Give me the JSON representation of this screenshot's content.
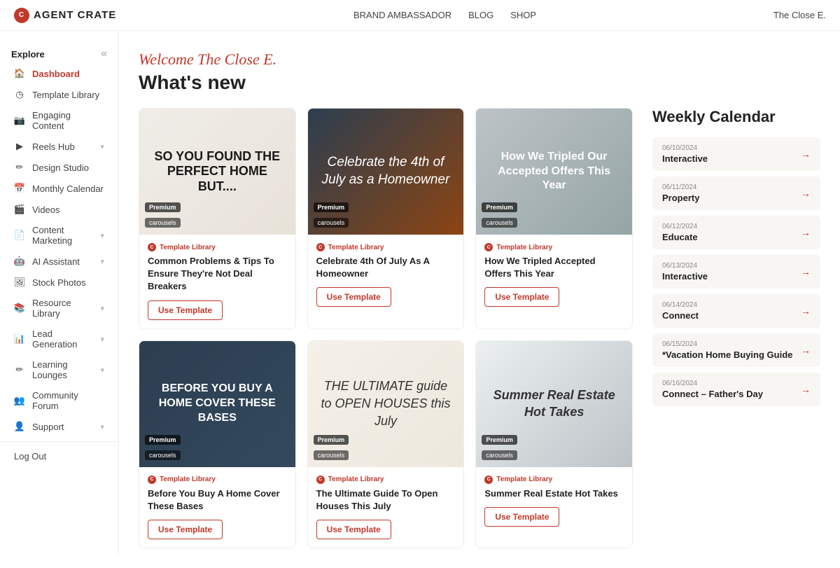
{
  "topNav": {
    "brand": "AGENT CRATE",
    "links": [
      "BRAND AMBASSADOR",
      "BLOG",
      "SHOP"
    ],
    "user": "The Close E."
  },
  "sidebar": {
    "explore_label": "Explore",
    "items": [
      {
        "id": "dashboard",
        "label": "Dashboard",
        "icon": "🏠",
        "active": true,
        "hasChevron": false
      },
      {
        "id": "template-library",
        "label": "Template Library",
        "icon": "◷",
        "active": false,
        "hasChevron": false
      },
      {
        "id": "engaging-content",
        "label": "Engaging Content",
        "icon": "📷",
        "active": false,
        "hasChevron": false
      },
      {
        "id": "reels-hub",
        "label": "Reels Hub",
        "icon": "▶",
        "active": false,
        "hasChevron": true
      },
      {
        "id": "design-studio",
        "label": "Design Studio",
        "icon": "✏️",
        "active": false,
        "hasChevron": false
      },
      {
        "id": "monthly-calendar",
        "label": "Monthly Calendar",
        "icon": "📅",
        "active": false,
        "hasChevron": false
      },
      {
        "id": "videos",
        "label": "Videos",
        "icon": "🎬",
        "active": false,
        "hasChevron": false
      },
      {
        "id": "content-marketing",
        "label": "Content Marketing",
        "icon": "📄",
        "active": false,
        "hasChevron": true
      },
      {
        "id": "ai-assistant",
        "label": "AI Assistant",
        "icon": "🤖",
        "active": false,
        "hasChevron": true
      },
      {
        "id": "stock-photos",
        "label": "Stock Photos",
        "icon": "🖼",
        "active": false,
        "hasChevron": false
      },
      {
        "id": "resource-library",
        "label": "Resource Library",
        "icon": "📚",
        "active": false,
        "hasChevron": true
      },
      {
        "id": "lead-generation",
        "label": "Lead Generation",
        "icon": "📊",
        "active": false,
        "hasChevron": true
      },
      {
        "id": "learning-lounges",
        "label": "Learning Lounges",
        "icon": "✏",
        "active": false,
        "hasChevron": true
      },
      {
        "id": "community-forum",
        "label": "Community Forum",
        "icon": "👥",
        "active": false,
        "hasChevron": false
      },
      {
        "id": "support",
        "label": "Support",
        "icon": "👤",
        "active": false,
        "hasChevron": true
      },
      {
        "id": "log-out",
        "label": "Log Out",
        "icon": "",
        "active": false,
        "hasChevron": false
      }
    ]
  },
  "main": {
    "welcome": "Welcome The Close E.",
    "whats_new": "What's new",
    "cards": [
      {
        "id": "card-1",
        "source": "Template Library",
        "title": "Common Problems & Tips To Ensure They're Not Deal Breakers",
        "badge": "Premium",
        "type": "carousels",
        "btn_label": "Use Template",
        "img_text": "SO YOU FOUND THE PERFECT HOME BUT....",
        "img_class": "card-img-1"
      },
      {
        "id": "card-2",
        "source": "Template Library",
        "title": "Celebrate 4th Of July As A Homeowner",
        "badge": "Premium",
        "type": "carousels",
        "btn_label": "Use Template",
        "img_text": "Celebrate the 4th of July as a Homeowner",
        "img_class": "card-img-2"
      },
      {
        "id": "card-3",
        "source": "Template Library",
        "title": "How We Tripled Accepted Offers This Year",
        "badge": "Premium",
        "type": "carousels",
        "btn_label": "Use Template",
        "img_text": "How We Tripled Our Accepted Offers This Year",
        "img_class": "card-img-3"
      },
      {
        "id": "card-4",
        "source": "Template Library",
        "title": "Before You Buy A Home Cover These Bases",
        "badge": "Premium",
        "type": "carousels",
        "btn_label": "Use Template",
        "img_text": "BEFORE YOU BUY A HOME COVER THESE BASES",
        "img_class": "card-img-4"
      },
      {
        "id": "card-5",
        "source": "Template Library",
        "title": "The Ultimate Guide To Open Houses This July",
        "badge": "Premium",
        "type": "carousels",
        "btn_label": "Use Template",
        "img_text": "THE ULTIMATE guide to OPEN HOUSES this July",
        "img_class": "card-img-5"
      },
      {
        "id": "card-6",
        "source": "Template Library",
        "title": "Summer Real Estate Hot Takes",
        "badge": "Premium",
        "type": "carousels",
        "btn_label": "Use Template",
        "img_text": "Summer Real Estate Hot Takes",
        "img_class": "card-img-6"
      }
    ]
  },
  "weekly_calendar": {
    "title": "Weekly Calendar",
    "items": [
      {
        "date": "06/10/2024",
        "label": "Interactive"
      },
      {
        "date": "06/11/2024",
        "label": "Property"
      },
      {
        "date": "06/12/2024",
        "label": "Educate"
      },
      {
        "date": "06/13/2024",
        "label": "Interactive"
      },
      {
        "date": "06/14/2024",
        "label": "Connect"
      },
      {
        "date": "06/15/2024",
        "label": "*Vacation Home Buying Guide"
      },
      {
        "date": "06/16/2024",
        "label": "Connect – Father's Day"
      }
    ]
  }
}
